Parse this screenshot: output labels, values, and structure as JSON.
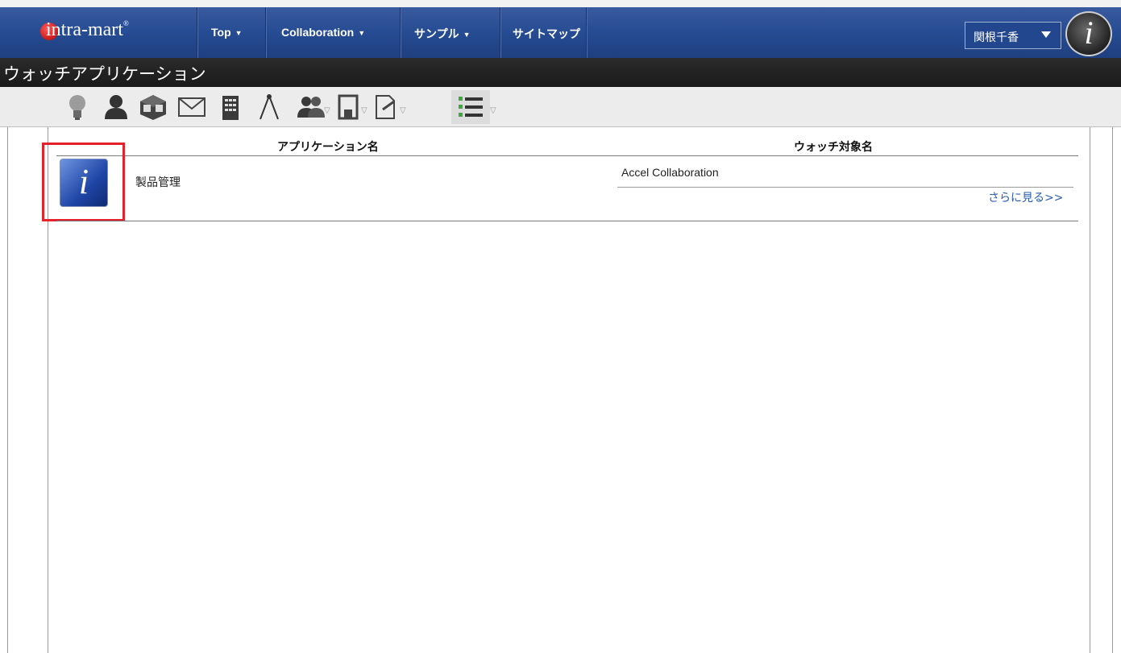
{
  "header": {
    "logo_text": "intra-mart",
    "logo_reg": "®",
    "nav": [
      {
        "label": "Top",
        "has_dropdown": true
      },
      {
        "label": "Collaboration",
        "has_dropdown": true
      },
      {
        "label": "サンプル",
        "has_dropdown": true
      },
      {
        "label": "サイトマップ",
        "has_dropdown": false
      }
    ],
    "user_name": "関根千香",
    "corner_logo_glyph": "i"
  },
  "page": {
    "title": "ウォッチアプリケーション"
  },
  "toolbar": {
    "icons": [
      "lightbulb-icon",
      "person-icon",
      "cube-icon",
      "mail-icon",
      "building-icon",
      "compass-icon",
      "group-icon",
      "document-icon",
      "note-icon",
      "checklist-icon"
    ]
  },
  "table": {
    "headers": [
      "アプリケーション名",
      "ウォッチ対象名"
    ],
    "rows": [
      {
        "icon_glyph": "i",
        "app_name": "製品管理",
        "target_name": "Accel Collaboration",
        "more_link": "さらに見る>>"
      }
    ]
  },
  "colors": {
    "nav_blue": "#264c93",
    "title_bar": "#1a1a1a",
    "highlight_red": "#e5212b",
    "link_blue": "#2a5db0"
  }
}
